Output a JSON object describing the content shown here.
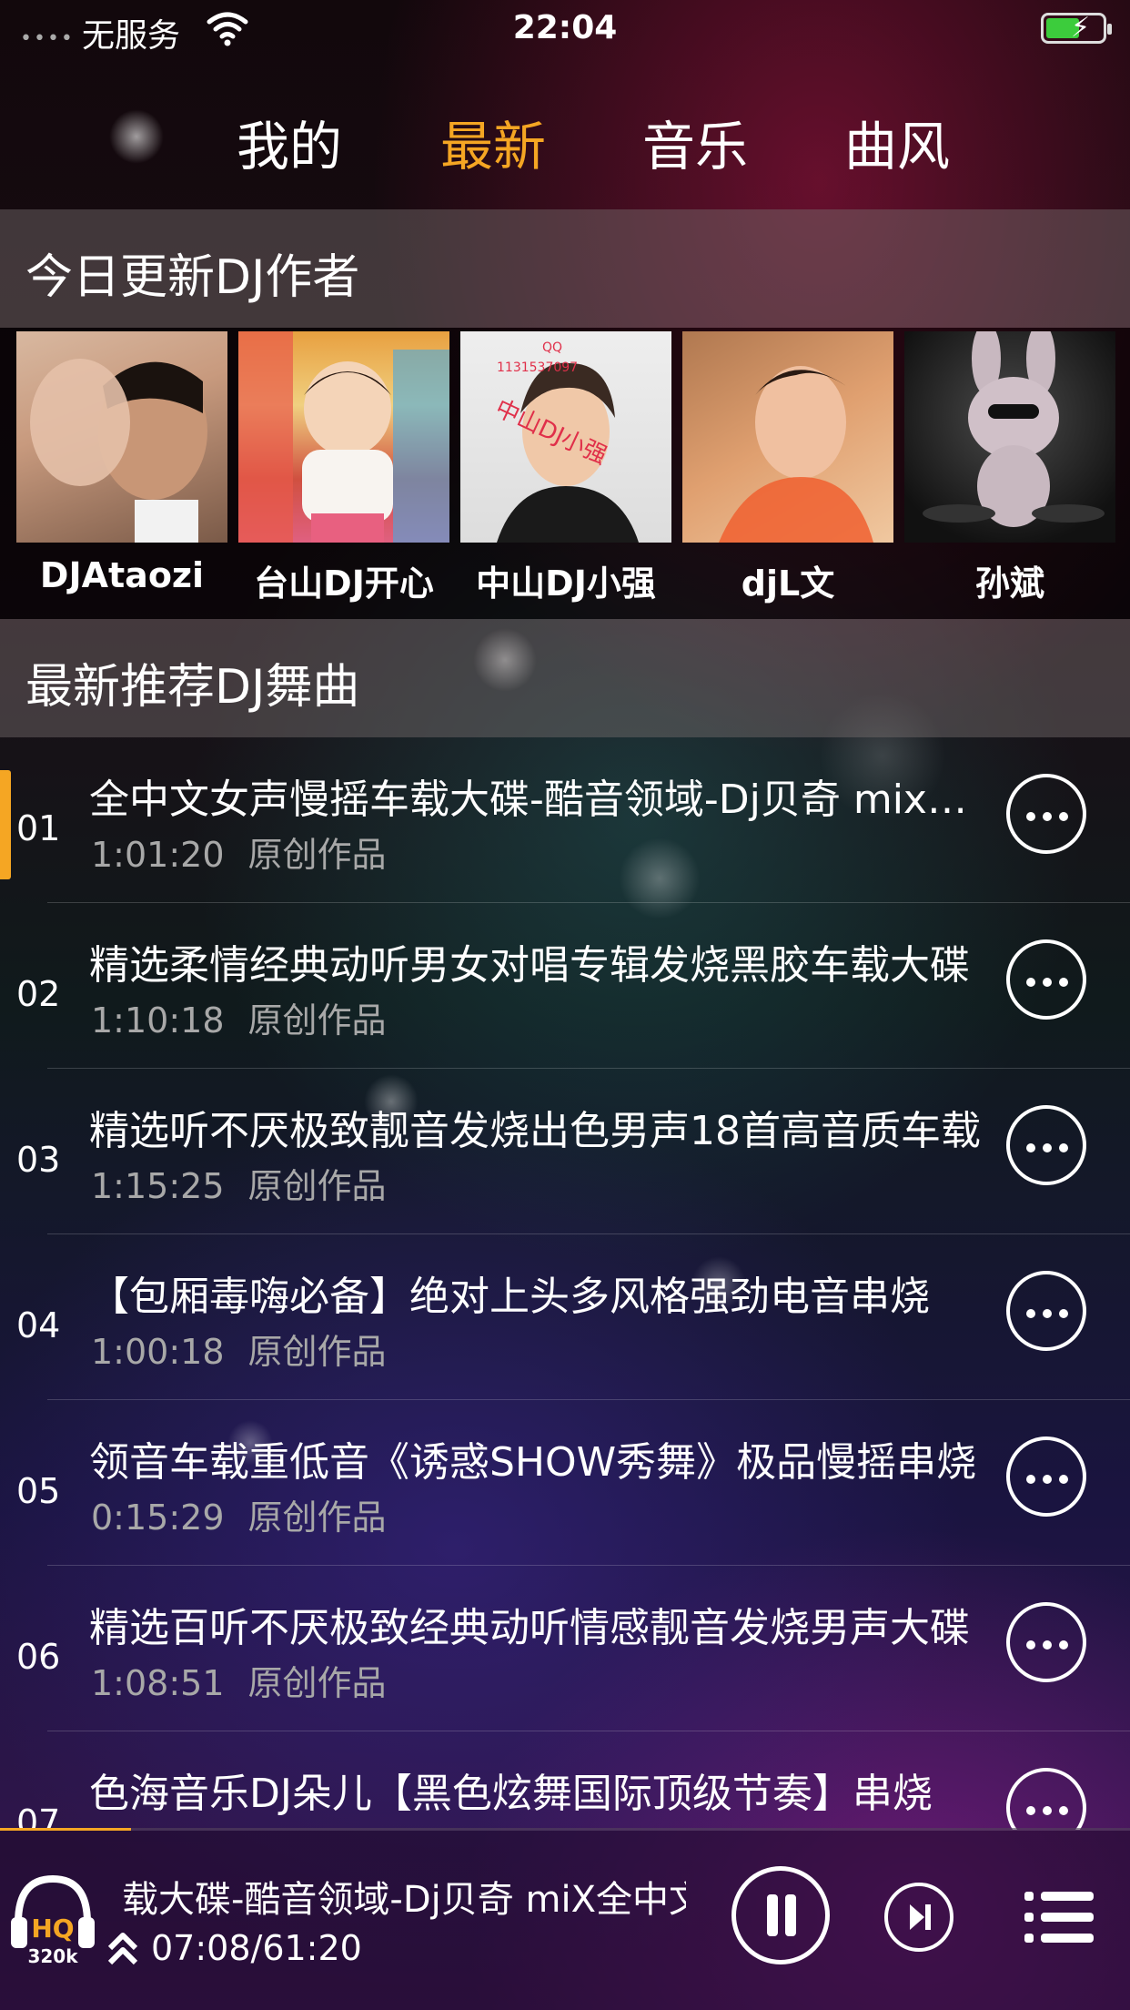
{
  "status_bar": {
    "signal": "••••",
    "carrier": "无服务",
    "time": "22:04"
  },
  "tabs": [
    {
      "label": "我的",
      "active": false
    },
    {
      "label": "最新",
      "active": true
    },
    {
      "label": "音乐",
      "active": false
    },
    {
      "label": "曲风",
      "active": false
    }
  ],
  "authors_section": {
    "title": "今日更新DJ作者",
    "authors": [
      {
        "name": "DJAtaozi"
      },
      {
        "name": "台山DJ开心"
      },
      {
        "name": "中山DJ小强",
        "photo_overlay": [
          "QQ",
          "1131537097",
          "中山DJ小强"
        ]
      },
      {
        "name": "djL文"
      },
      {
        "name": "孙斌"
      }
    ]
  },
  "songs_section": {
    "title": "最新推荐DJ舞曲",
    "songs": [
      {
        "index": "01",
        "title": "全中文女声慢摇车载大碟-酷音领域-Dj贝奇 mix全中文女声慢摇车载大碟",
        "duration": "1:01:20",
        "tag": "原创作品",
        "playing": true
      },
      {
        "index": "02",
        "title": "精选柔情经典动听男女对唱专辑发烧黑胶车载大碟",
        "duration": "1:10:18",
        "tag": "原创作品",
        "playing": false
      },
      {
        "index": "03",
        "title": "精选听不厌极致靓音发烧出色男声18首高音质车载",
        "duration": "1:15:25",
        "tag": "原创作品",
        "playing": false
      },
      {
        "index": "04",
        "title": "【包厢毒嗨必备】绝对上头多风格强劲电音串烧",
        "duration": "1:00:18",
        "tag": "原创作品",
        "playing": false
      },
      {
        "index": "05",
        "title": "领音车载重低音《诱惑SHOW秀舞》极品慢摇串烧",
        "duration": "0:15:29",
        "tag": "原创作品",
        "playing": false
      },
      {
        "index": "06",
        "title": "精选百听不厌极致经典动听情感靓音发烧男声大碟",
        "duration": "1:08:51",
        "tag": "原创作品",
        "playing": false
      },
      {
        "index": "07",
        "title": "色海音乐DJ朵儿【黑色炫舞国际顶级节奏】串烧",
        "duration": "",
        "tag": "",
        "playing": false
      }
    ]
  },
  "player": {
    "quality_label": "HQ",
    "bitrate": "320k",
    "now_playing": "载大碟-酷音领域-Dj贝奇 miX全中文女声慢摇车载大碟",
    "time": "07:08/61:20",
    "progress_fraction": 0.116,
    "accent_color": "#f5a623"
  },
  "colors": {
    "accent": "#f5a623",
    "text": "#ffffff",
    "secondary_text": "#a8a8a8"
  }
}
